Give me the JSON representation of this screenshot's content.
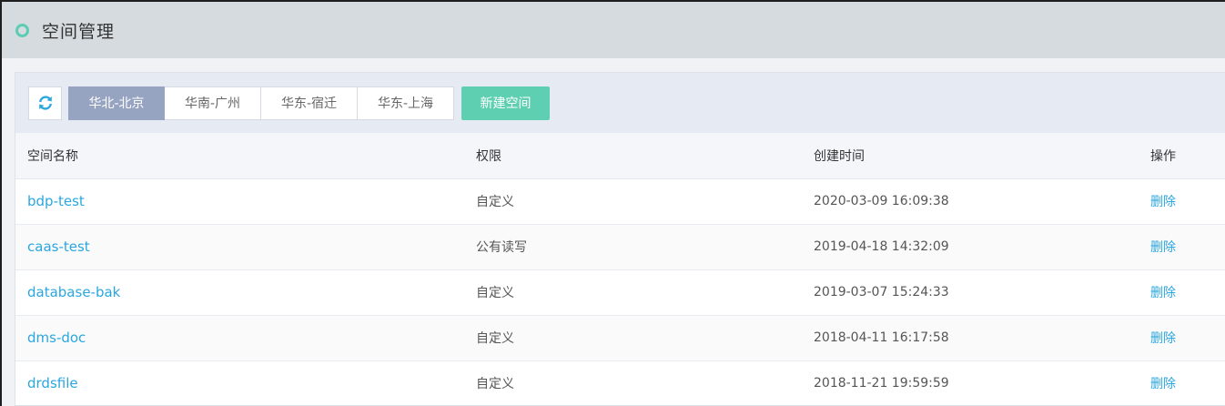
{
  "header": {
    "title": "空间管理"
  },
  "toolbar": {
    "regions": [
      {
        "label": "华北-北京",
        "active": true
      },
      {
        "label": "华南-广州",
        "active": false
      },
      {
        "label": "华东-宿迁",
        "active": false
      },
      {
        "label": "华东-上海",
        "active": false
      }
    ],
    "new_label": "新建空间"
  },
  "table": {
    "columns": [
      "空间名称",
      "权限",
      "创建时间",
      "操作"
    ],
    "rows": [
      {
        "name": "bdp-test",
        "permission": "自定义",
        "created": "2020-03-09 16:09:38",
        "action": "删除"
      },
      {
        "name": "caas-test",
        "permission": "公有读写",
        "created": "2019-04-18 14:32:09",
        "action": "删除"
      },
      {
        "name": "database-bak",
        "permission": "自定义",
        "created": "2019-03-07 15:24:33",
        "action": "删除"
      },
      {
        "name": "dms-doc",
        "permission": "自定义",
        "created": "2018-04-11 16:17:58",
        "action": "删除"
      },
      {
        "name": "drdsfile",
        "permission": "自定义",
        "created": "2018-11-21 19:59:59",
        "action": "删除"
      }
    ]
  },
  "colors": {
    "accent": "#5fcfb1",
    "link": "#2aa7e0",
    "active_tab": "#97a4c1"
  }
}
